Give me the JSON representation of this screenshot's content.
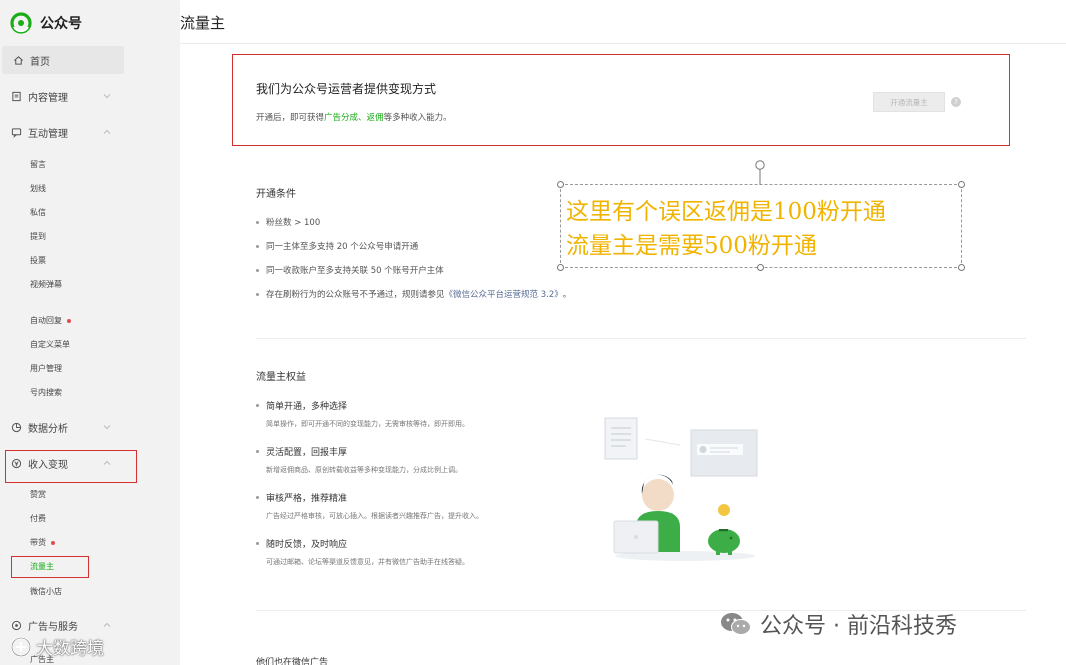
{
  "brand": {
    "name": "公众号",
    "accent": "#1aad19"
  },
  "header": {
    "title": "流量主"
  },
  "sidebar": {
    "items": [
      {
        "label": "首页",
        "icon": "home-icon"
      },
      {
        "label": "内容管理",
        "icon": "document-icon"
      },
      {
        "label": "互动管理",
        "icon": "chat-icon"
      },
      {
        "label": "数据分析",
        "icon": "chart-icon"
      },
      {
        "label": "收入变现",
        "icon": "money-icon"
      },
      {
        "label": "广告与服务",
        "icon": "ad-icon"
      }
    ],
    "interaction_sub": [
      "留言",
      "划线",
      "私信",
      "提到",
      "投票",
      "视频弹幕"
    ],
    "more_sub": [
      {
        "label": "自动回复",
        "dot": true
      },
      {
        "label": "自定义菜单"
      },
      {
        "label": "用户管理"
      },
      {
        "label": "号内搜索"
      }
    ],
    "income_sub": [
      {
        "label": "赞赏"
      },
      {
        "label": "付费"
      },
      {
        "label": "带货",
        "dot": true
      },
      {
        "label": "流量主",
        "active": true
      },
      {
        "label": "微信小店"
      }
    ],
    "bottom_label": "广告主"
  },
  "intro": {
    "title": "我们为公众号运营者提供变现方式",
    "desc_prefix": "开通后，即可获得",
    "desc_hl1": "广告分成",
    "desc_sep": "、",
    "desc_hl2": "返佣",
    "desc_suffix": "等多种收入能力。",
    "button": "开通流量主",
    "help": "?"
  },
  "conditions": {
    "title": "开通条件",
    "items": [
      "粉丝数 > 100",
      "同一主体至多支持 20 个公众号申请开通",
      "同一收款账户至多支持关联 50 个账号开户主体"
    ],
    "last_prefix": "存在刷粉行为的公众账号不予通过，规则请参见",
    "last_link": "《微信公众平台运营规范 3.2》",
    "last_suffix": "。"
  },
  "benefits": {
    "title": "流量主权益",
    "items": [
      {
        "title": "简单开通，多种选择",
        "desc": "简单操作，即可开通不同的变现能力，无需审核等待，即开即用。"
      },
      {
        "title": "灵活配置，回报丰厚",
        "desc": "新增返佣商品、原创转载收益等多种变现能力，分成比例上调。"
      },
      {
        "title": "审核严格，推荐精准",
        "desc": "广告经过严格审核，可放心插入。根据读者兴趣推荐广告，提升收入。"
      },
      {
        "title": "随时反馈，及时响应",
        "desc": "可通过邮箱、论坛等渠道反馈意见，并有微信广告助手在线答疑。"
      }
    ]
  },
  "more_section_title": "他们也在微信广告",
  "annotation": {
    "line1": "这里有个误区返佣是100粉开通",
    "line2": "流量主是需要500粉开通",
    "color": "#f0b400"
  },
  "watermark": {
    "right": "公众号 · 前沿科技秀",
    "left": "大数跨境"
  }
}
